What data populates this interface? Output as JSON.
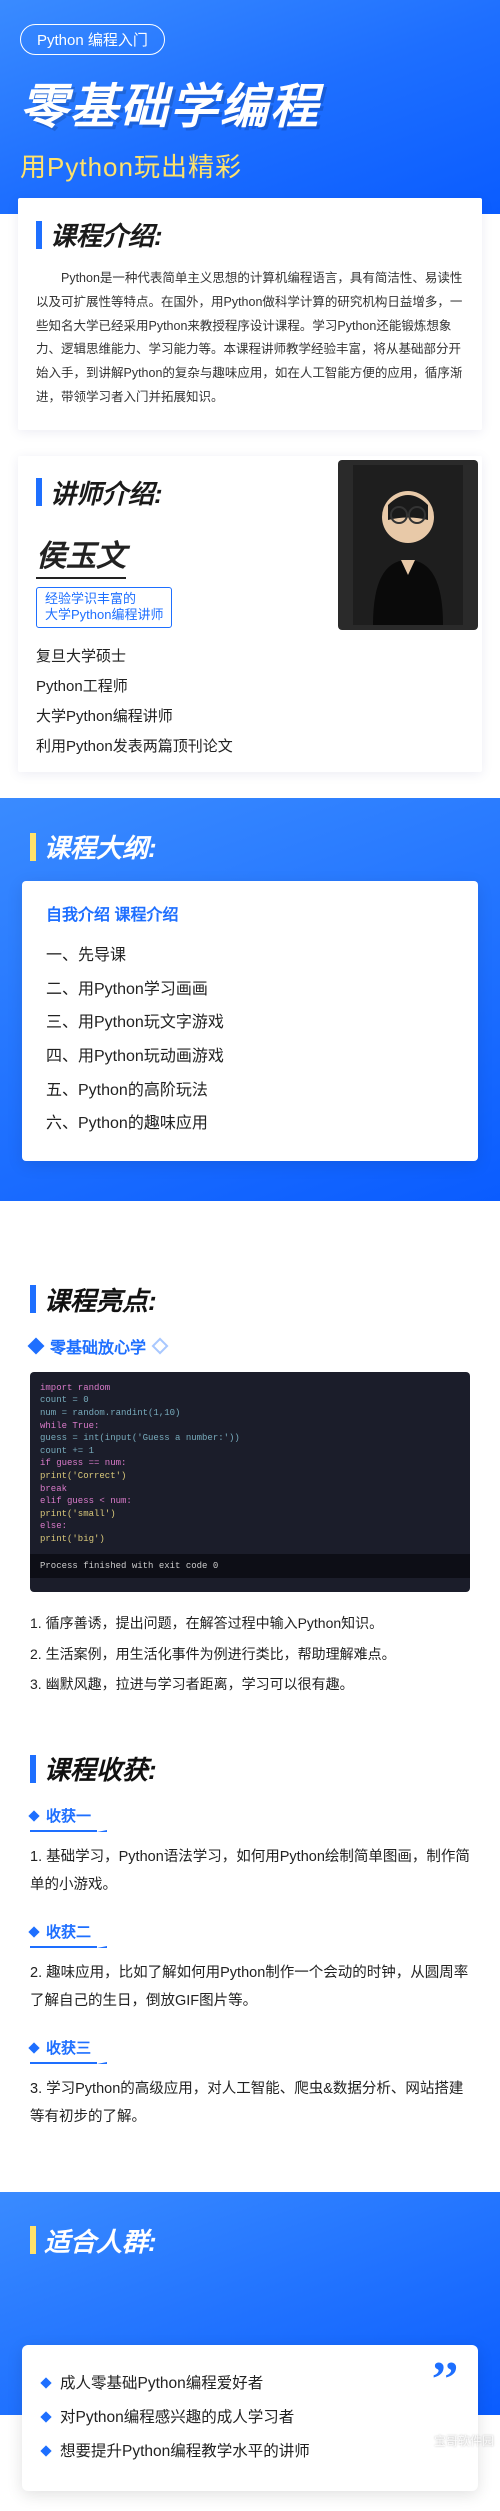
{
  "hero": {
    "badge": "Python 编程入门",
    "title": "零基础学编程",
    "subtitle": "用Python玩出精彩"
  },
  "intro": {
    "heading": "课程介绍:",
    "body": "Python是一种代表简单主义思想的计算机编程语言，具有简洁性、易读性以及可扩展性等特点。在国外，用Python做科学计算的研究机构日益增多，一些知名大学已经采用Python来教授程序设计课程。学习Python还能锻炼想象力、逻辑思维能力、学习能力等。本课程讲师教学经验丰富，将从基础部分开始入手，到讲解Python的复杂与趣味应用，如在人工智能方便的应用，循序渐进，带领学习者入门并拓展知识。"
  },
  "instructor": {
    "heading": "讲师介绍:",
    "name": "侯玉文",
    "tag": "经验学识丰富的\n大学Python编程讲师",
    "credentials": [
      "复旦大学硕士",
      "Python工程师",
      "大学Python编程讲师",
      "利用Python发表两篇顶刊论文"
    ]
  },
  "outline": {
    "heading": "课程大纲:",
    "sub": "自我介绍 课程介绍",
    "items": [
      "一、先导课",
      "二、用Python学习画画",
      "三、用Python玩文字游戏",
      "四、用Python玩动画游戏",
      "五、Python的高阶玩法",
      "六、Python的趣味应用"
    ]
  },
  "highlights": {
    "heading": "课程亮点:",
    "tag": "零基础放心学",
    "code_lines": [
      "import random",
      "count = 0",
      "num = random.randint(1,10)",
      "",
      "while True:",
      "    guess = int(input('Guess a number:'))",
      "    count += 1",
      "    if guess == num:",
      "        print('Correct')",
      "        break",
      "    elif guess < num:",
      "        print('small')",
      "    else:",
      "        print('big')"
    ],
    "code_footer": "Process finished with exit code 0",
    "points": [
      "1. 循序善诱，提出问题，在解答过程中输入Python知识。",
      "2. 生活案例，用生活化事件为例进行类比，帮助理解难点。",
      "3. 幽默风趣，拉进与学习者距离，学习可以很有趣。"
    ]
  },
  "gains": {
    "heading": "课程收获:",
    "items": [
      {
        "label": "收获一",
        "text": "1. 基础学习，Python语法学习，如何用Python绘制简单图画，制作简单的小游戏。"
      },
      {
        "label": "收获二",
        "text": "2. 趣味应用，比如了解如何用Python制作一个会动的时钟，从圆周率了解自己的生日，倒放GIF图片等。"
      },
      {
        "label": "收获三",
        "text": "3. 学习Python的高级应用，对人工智能、爬虫&数据分析、网站搭建等有初步的了解。"
      }
    ]
  },
  "audience": {
    "heading": "适合人群:",
    "items": [
      "成人零基础Python编程爱好者",
      "对Python编程感兴趣的成人学习者",
      "想要提升Python编程教学水平的讲师"
    ]
  },
  "watermark": "宝哥软件园"
}
